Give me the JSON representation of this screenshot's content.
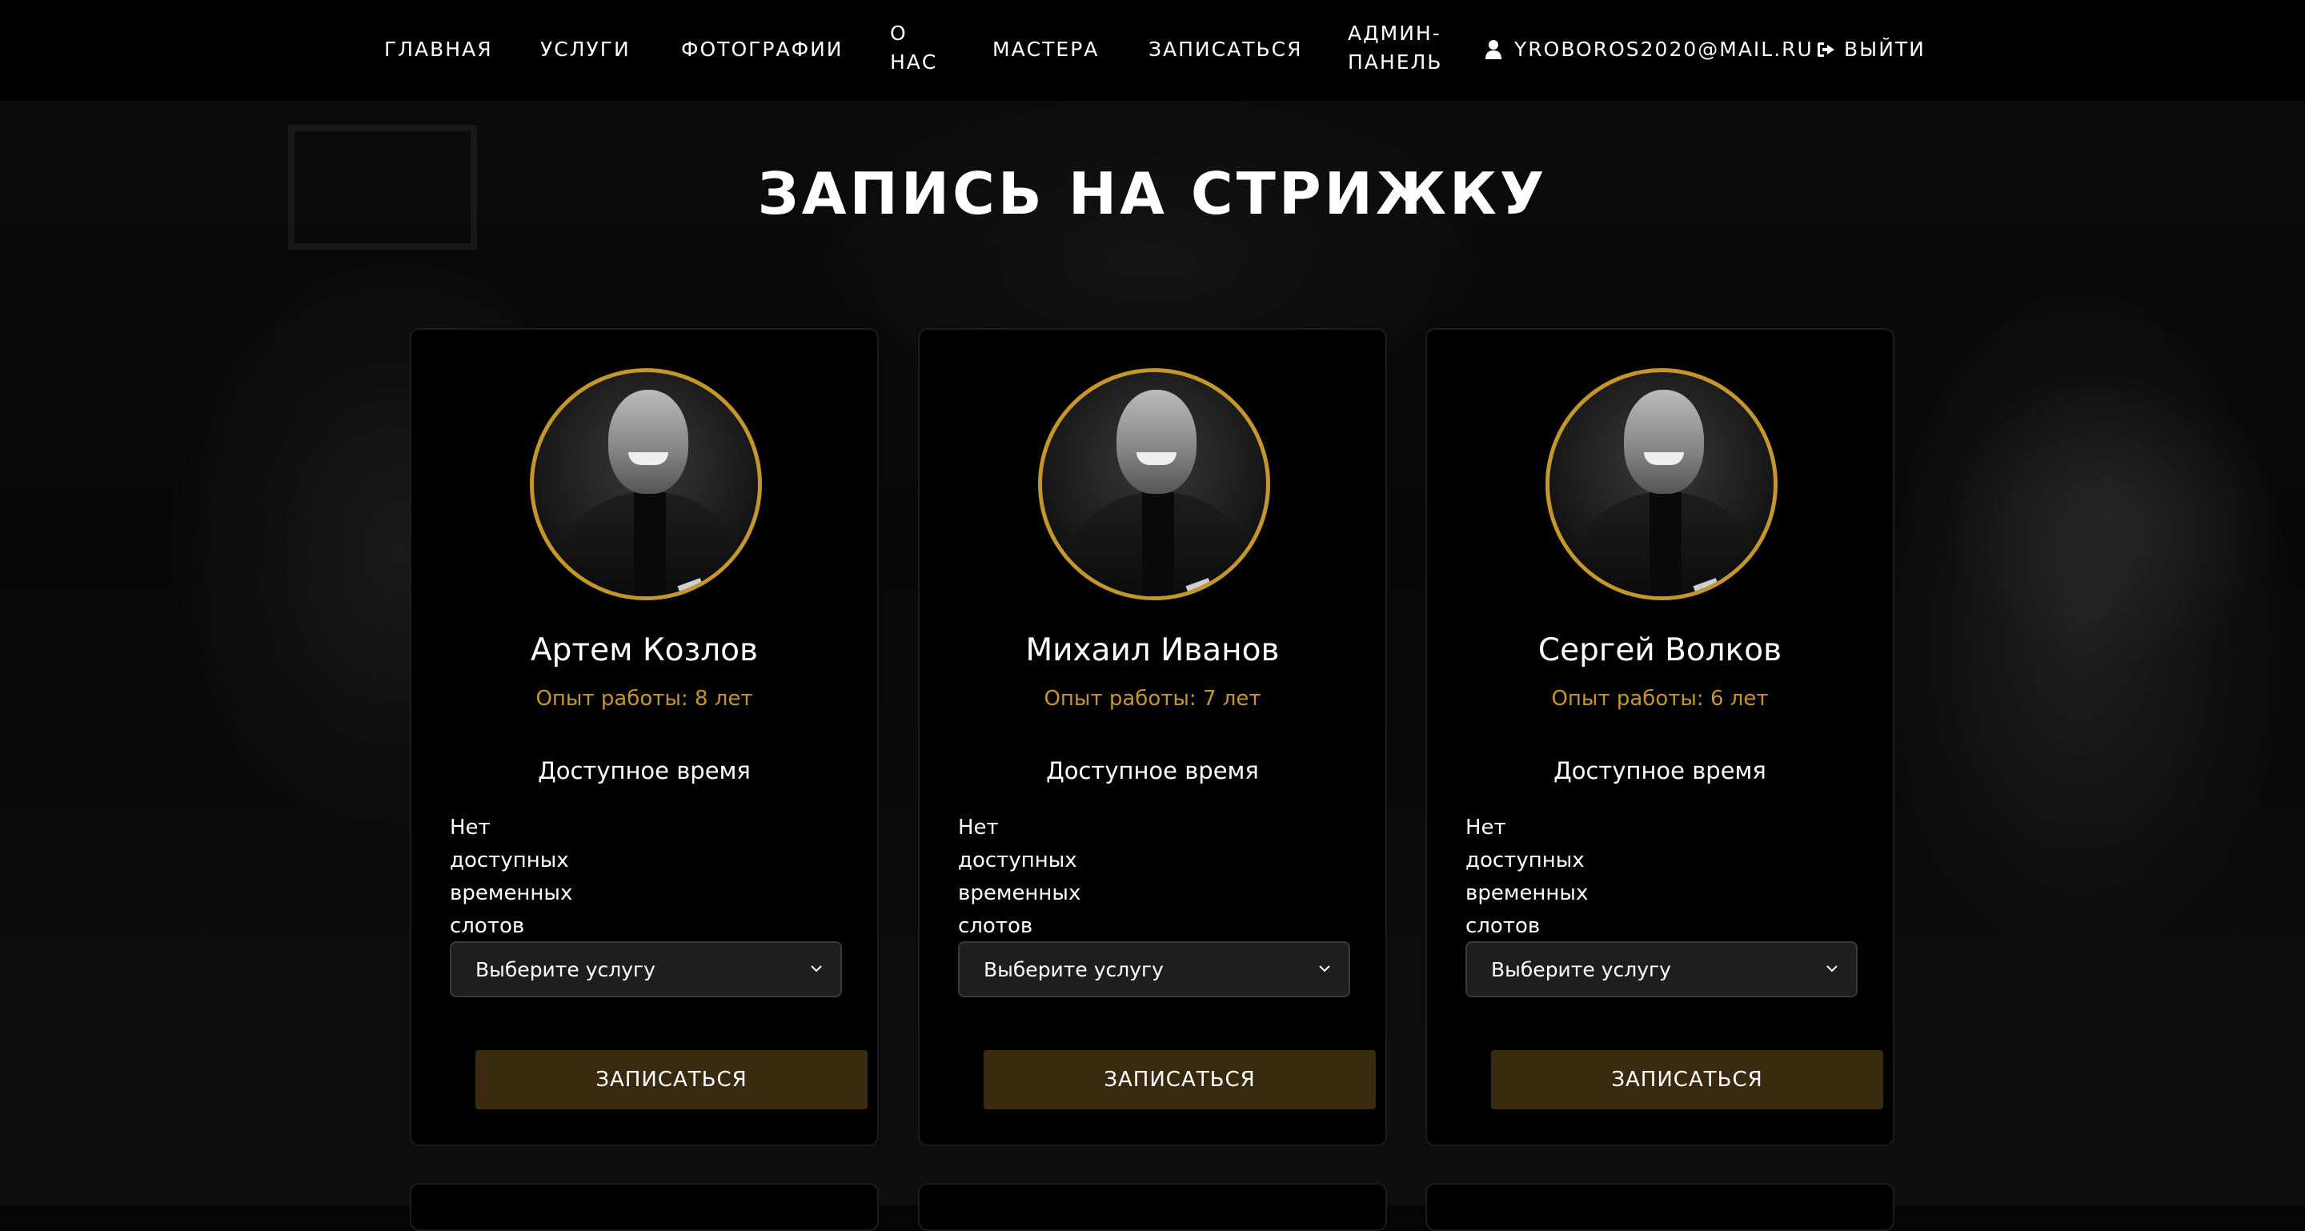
{
  "nav": {
    "items": [
      {
        "label": "ГЛАВНАЯ"
      },
      {
        "label": "УСЛУГИ"
      },
      {
        "label": "ФОТОГРАФИИ"
      },
      {
        "label_line1": "О",
        "label_line2": "НАС"
      },
      {
        "label": "МАСТЕРА"
      },
      {
        "label": "ЗАПИСАТЬСЯ"
      },
      {
        "label_line1": "АДМИН-",
        "label_line2": "ПАНЕЛЬ"
      }
    ],
    "user_email": "YROBOROS2020@MAIL.RU",
    "logout_label": "ВЫЙТИ",
    "user_icon": "user-icon",
    "logout_icon": "sign-out-icon"
  },
  "page": {
    "title": "ЗАПИСЬ НА СТРИЖКУ"
  },
  "colors": {
    "accent": "#c4962c",
    "button_bg": "#3a2a10",
    "card_bg": "#000000",
    "select_bg": "#1e1e1e"
  },
  "masters": [
    {
      "name": "Артем Козлов",
      "experience": "Опыт работы: 8 лет",
      "available_heading": "Доступное время",
      "no_slots": [
        "Нет",
        "доступных",
        "временных",
        "слотов"
      ],
      "service_select": "Выберите услугу",
      "book_button": "ЗАПИСАТЬСЯ"
    },
    {
      "name": "Михаил Иванов",
      "experience": "Опыт работы: 7 лет",
      "available_heading": "Доступное время",
      "no_slots": [
        "Нет",
        "доступных",
        "временных",
        "слотов"
      ],
      "service_select": "Выберите услугу",
      "book_button": "ЗАПИСАТЬСЯ"
    },
    {
      "name": "Сергей Волков",
      "experience": "Опыт работы: 6 лет",
      "available_heading": "Доступное время",
      "no_slots": [
        "Нет",
        "доступных",
        "временных",
        "слотов"
      ],
      "service_select": "Выберите услугу",
      "book_button": "ЗАПИСАТЬСЯ"
    }
  ]
}
